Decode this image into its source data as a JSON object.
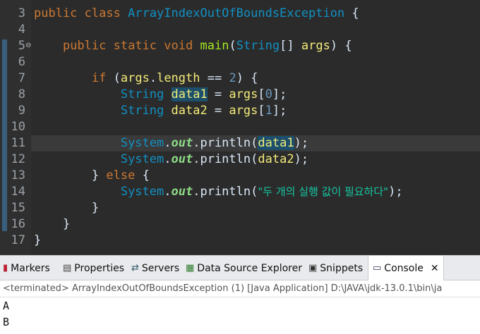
{
  "editor": {
    "line_numbers": [
      "3",
      "4",
      "5",
      "6",
      "7",
      "8",
      "9",
      "10",
      "11",
      "12",
      "13",
      "14",
      "15",
      "16",
      "17"
    ],
    "tokens": {
      "kw_public": "public",
      "kw_class": "class",
      "class_name": "ArrayIndexOutOfBoundsException",
      "brace_open": "{",
      "brace_close": "}",
      "kw_static": "static",
      "kw_void": "void",
      "main": "main",
      "paren_open": "(",
      "paren_close": ")",
      "String": "String",
      "brackets": "[]",
      "args": "args",
      "kw_if": "if",
      "length": "length",
      "eq": " == ",
      "two": "2",
      "data1": "data1",
      "data2": "data2",
      "assign": " = ",
      "idx0": "0",
      "idx1": "1",
      "semi": ";",
      "System": "System",
      "dot": ".",
      "out": "out",
      "println": "println",
      "kw_else": "else",
      "korean_string": "\"두 개의 실행 값이 필요하다\""
    }
  },
  "console": {
    "tabs": [
      {
        "label": "Markers",
        "icon": "markers-icon"
      },
      {
        "label": "Properties",
        "icon": "properties-icon"
      },
      {
        "label": "Servers",
        "icon": "servers-icon"
      },
      {
        "label": "Data Source Explorer",
        "icon": "data-source-icon"
      },
      {
        "label": "Snippets",
        "icon": "snippets-icon"
      },
      {
        "label": "Console",
        "icon": "console-icon"
      }
    ],
    "status": "<terminated> ArrayIndexOutOfBoundsException (1) [Java Application] D:\\JAVA\\jdk-13.0.1\\bin\\ja",
    "output": [
      "A",
      "B"
    ]
  }
}
